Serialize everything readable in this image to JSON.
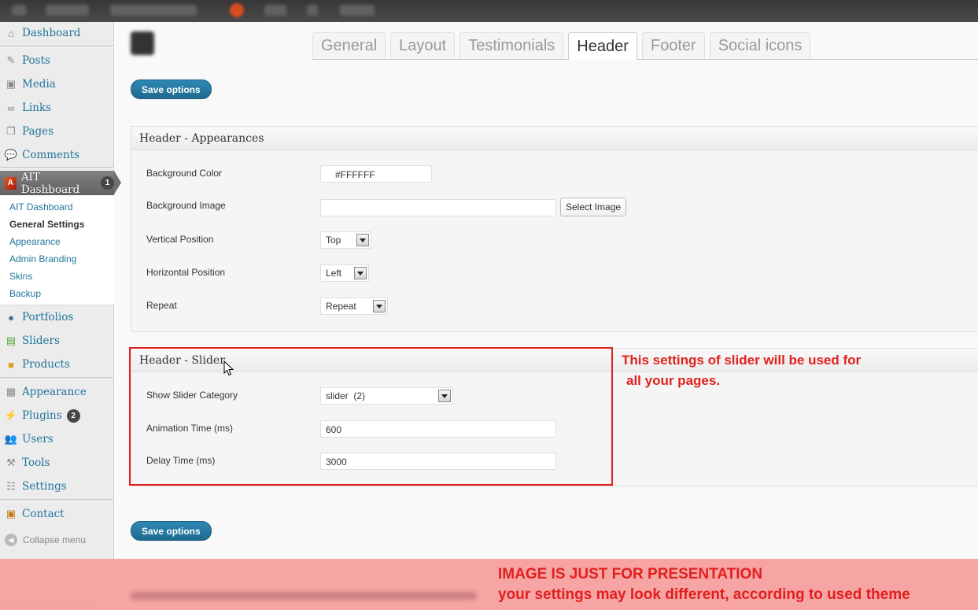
{
  "sidebar": {
    "items": [
      {
        "label": "Dashboard",
        "icon": "dashboard-icon"
      },
      {
        "label": "Posts",
        "icon": "pin-icon"
      },
      {
        "label": "Media",
        "icon": "media-icon"
      },
      {
        "label": "Links",
        "icon": "link-icon"
      },
      {
        "label": "Pages",
        "icon": "pages-icon"
      },
      {
        "label": "Comments",
        "icon": "comments-icon"
      }
    ],
    "active": {
      "label": "AIT Dashboard",
      "count": "1"
    },
    "submenu": [
      "AIT Dashboard",
      "General Settings",
      "Appearance",
      "Admin Branding",
      "Skins",
      "Backup"
    ],
    "items_lower": [
      {
        "label": "Portfolios"
      },
      {
        "label": "Sliders"
      },
      {
        "label": "Products"
      }
    ],
    "items_bottom": [
      {
        "label": "Appearance"
      },
      {
        "label": "Plugins",
        "count": "2"
      },
      {
        "label": "Users"
      },
      {
        "label": "Tools"
      },
      {
        "label": "Settings"
      }
    ],
    "contact": "Contact",
    "collapse": "Collapse menu"
  },
  "tabs": [
    "General",
    "Layout",
    "Testimonials",
    "Header",
    "Footer",
    "Social icons"
  ],
  "active_tab": "Header",
  "save_label": "Save options",
  "appearance": {
    "title": "Header - Appearances",
    "bg_color_label": "Background Color",
    "bg_color_value": "#FFFFFF",
    "bg_image_label": "Background Image",
    "bg_image_value": "",
    "select_image_label": "Select Image",
    "vpos_label": "Vertical Position",
    "vpos_value": "Top",
    "hpos_label": "Horizontal Position",
    "hpos_value": "Left",
    "repeat_label": "Repeat",
    "repeat_value": "Repeat"
  },
  "slider": {
    "title": "Header - Slider",
    "category_label": "Show Slider Category",
    "category_value": "slider  (2)",
    "anim_label": "Animation Time (ms)",
    "anim_value": "600",
    "delay_label": "Delay Time (ms)",
    "delay_value": "3000"
  },
  "notes": {
    "slider_note_1": "This settings of slider will be used for",
    "slider_note_2": "all your pages.",
    "disclaimer_1": "IMAGE IS JUST FOR PRESENTATION",
    "disclaimer_2": "your settings may look different, according to used theme"
  },
  "colors": {
    "accent": "#21759b",
    "highlight": "#e0201e",
    "overlay": "#f48282"
  }
}
